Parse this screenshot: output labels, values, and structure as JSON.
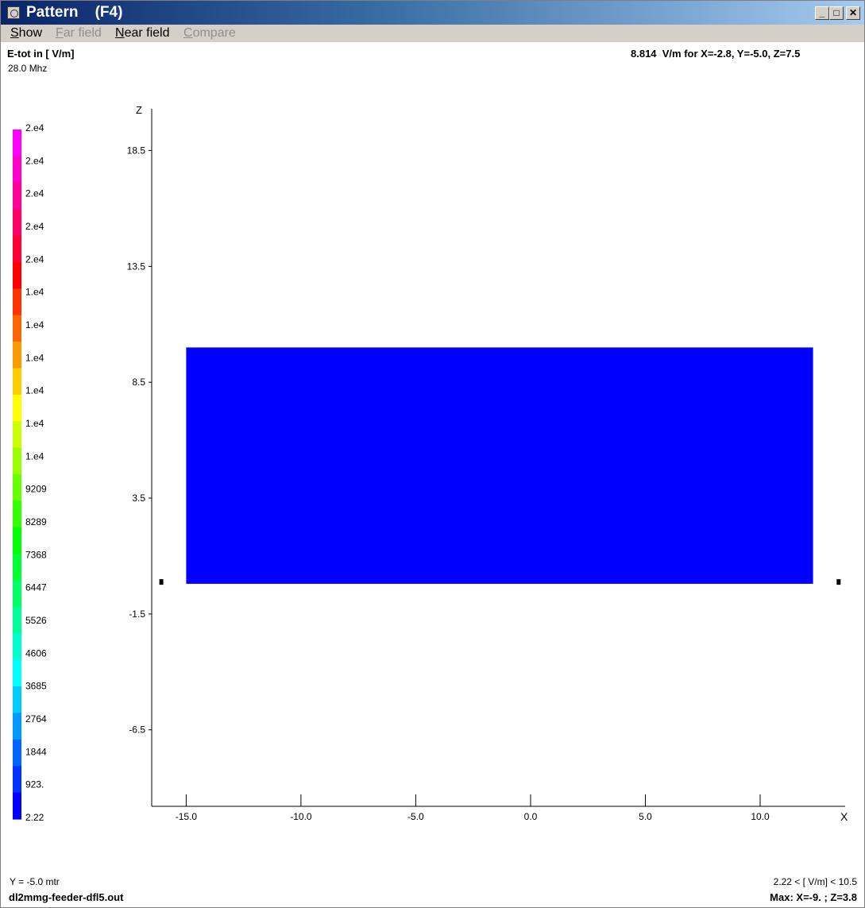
{
  "window": {
    "title": "Pattern    (F4)",
    "minimize_glyph": "_",
    "maximize_glyph": "□",
    "close_glyph": "✕"
  },
  "menu": {
    "items": [
      {
        "label": "Show",
        "ul": "S",
        "rest": "how",
        "enabled": true
      },
      {
        "label": "Far field",
        "ul": "F",
        "rest": "ar field",
        "enabled": false
      },
      {
        "label": "Near field",
        "ul": "N",
        "rest": "ear field",
        "enabled": true
      },
      {
        "label": "Compare",
        "ul": "C",
        "rest": "ompare",
        "enabled": false
      }
    ]
  },
  "header": {
    "quantity": "E-tot in [ V/m]",
    "frequency": "28.0 Mhz",
    "readout": "8.814  V/m for X=-2.8, Y=-5.0, Z=7.5"
  },
  "footer": {
    "plane": "Y = -5.0 mtr",
    "filename": "dl2mmg-feeder-dfl5.out",
    "range": "2.22 < [ V/m] < 10.5",
    "max": "Max: X=-9. ; Z=3.8"
  },
  "colors": {
    "field": "#0000ff",
    "scale": [
      "#ff00ff",
      "#ff00cc",
      "#ff0099",
      "#ff0066",
      "#ff0033",
      "#ff0000",
      "#ff3300",
      "#ff6600",
      "#ff9900",
      "#ffcc00",
      "#ffff00",
      "#ccff00",
      "#99ff00",
      "#66ff00",
      "#33ff00",
      "#00ff00",
      "#00ff33",
      "#00ff66",
      "#00ff99",
      "#00ffcc",
      "#00ffff",
      "#00ccff",
      "#0099ff",
      "#0066ff",
      "#0033ff",
      "#0000ff"
    ]
  },
  "legend": {
    "labels": [
      "2.e4",
      "2.e4",
      "2.e4",
      "2.e4",
      "2.e4",
      "1.e4",
      "1.e4",
      "1.e4",
      "1.e4",
      "1.e4",
      "1.e4",
      "9209",
      "8289",
      "7368",
      "6447",
      "5526",
      "4606",
      "3685",
      "2764",
      "1844",
      "923.",
      "2.22"
    ]
  },
  "chart_data": {
    "type": "heatmap",
    "xlabel": "X",
    "ylabel": "Z",
    "x_ticks": [
      -15.0,
      -10.0,
      -5.0,
      0.0,
      5.0,
      10.0
    ],
    "x_tick_labels": [
      "-15.0",
      "-10.0",
      "-5.0",
      "0.0",
      "5.0",
      "10.0"
    ],
    "y_ticks": [
      18.5,
      13.5,
      8.5,
      3.5,
      -1.5,
      -6.5
    ],
    "y_tick_labels": [
      "18.5",
      "13.5",
      "8.5",
      "3.5",
      "-1.5",
      "-6.5"
    ],
    "xlim": [
      -16.5,
      13.7
    ],
    "ylim": [
      -9.8,
      20.3
    ],
    "field_region": {
      "x": [
        -15.0,
        12.3
      ],
      "z": [
        -0.2,
        10.0
      ]
    },
    "field_value_range": [
      2.22,
      10.5
    ],
    "markers": [
      {
        "x": -16.1,
        "z": -0.1
      },
      {
        "x": 13.4,
        "z": -0.1
      }
    ]
  }
}
